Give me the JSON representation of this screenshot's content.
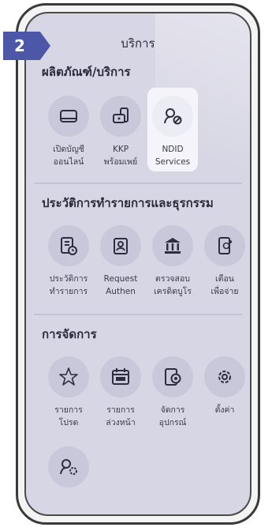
{
  "step_number": "2",
  "header": {
    "title": "บริการ"
  },
  "sections": [
    {
      "title": "ผลิตภัณฑ์/บริการ",
      "items": [
        {
          "line1": "เปิดบัญชี",
          "line2": "ออนไลน์",
          "icon": "card-icon"
        },
        {
          "line1": "KKP",
          "line2": "พร้อมเพย์",
          "icon": "promptpay-icon"
        },
        {
          "line1": "NDID",
          "line2": "Services",
          "icon": "ndid-icon",
          "highlighted": true
        }
      ]
    },
    {
      "title": "ประวัติการทำรายการและธุรกรรม",
      "items": [
        {
          "line1": "ประวัติการ",
          "line2": "ทำรายการ",
          "icon": "history-icon"
        },
        {
          "line1": "Request",
          "line2": "Authen",
          "icon": "request-authen-icon"
        },
        {
          "line1": "ตรวจสอบ",
          "line2": "เครดิตบูโร",
          "icon": "bank-icon"
        },
        {
          "line1": "เตือน",
          "line2": "เพื่อจ่าย",
          "icon": "payment-reminder-icon"
        }
      ]
    },
    {
      "title": "การจัดการ",
      "items": [
        {
          "line1": "รายการ",
          "line2": "โปรด",
          "icon": "star-icon"
        },
        {
          "line1": "รายการ",
          "line2": "ล่วงหน้า",
          "icon": "calendar-icon"
        },
        {
          "line1": "จัดการ",
          "line2": "อุปกรณ์",
          "icon": "device-settings-icon"
        },
        {
          "line1": "ตั้งค่า",
          "line2": "",
          "icon": "settings-icon"
        },
        {
          "line1": "",
          "line2": "",
          "icon": "user-settings-icon"
        }
      ]
    }
  ],
  "colors": {
    "screen_bg": "#d7d6e4",
    "icon_circle": "#c9c8db",
    "highlight_bg": "#f4f4fa",
    "badge": "#4c57a8",
    "text": "#2a2a3a"
  }
}
